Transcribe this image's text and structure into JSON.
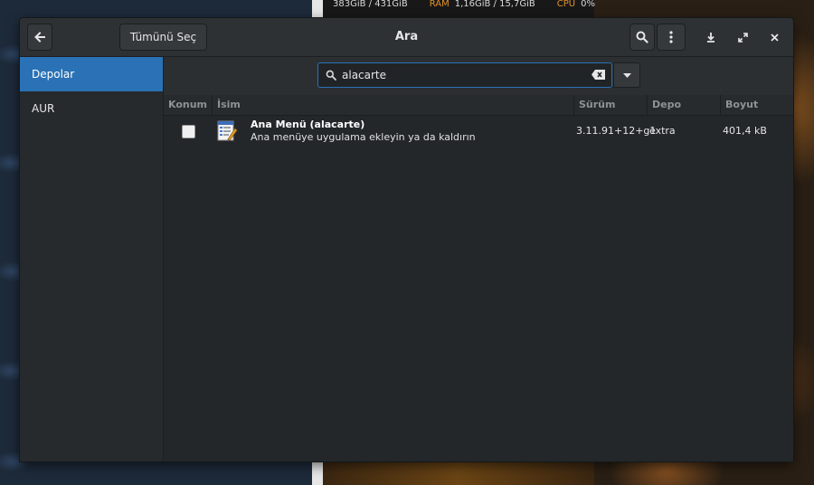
{
  "desktop": {
    "conky": {
      "disk_value": "383GiB / 431GiB",
      "ram_label": "RAM",
      "ram_value": "1,16GiB / 15,7GiB",
      "cpu_label": "CPU",
      "cpu_value": "0%"
    }
  },
  "window": {
    "title": "Ara",
    "select_all_label": "Tümünü Seç",
    "icons": {
      "back": "back-arrow-icon",
      "search": "search-icon",
      "menu": "kebab-menu-icon",
      "download": "download-icon",
      "maximize": "maximize-icon",
      "close": "close-icon"
    }
  },
  "sidebar": {
    "items": [
      {
        "label": "Depolar",
        "active": true
      },
      {
        "label": "AUR",
        "active": false
      }
    ]
  },
  "search": {
    "value": "alacarte",
    "placeholder": ""
  },
  "table": {
    "columns": [
      "Konum",
      "İsim",
      "Sürüm",
      "Depo",
      "Boyut"
    ],
    "rows": [
      {
        "checked": false,
        "name": "Ana Menü  (alacarte)",
        "description": "Ana menüye uygulama ekleyin ya da kaldırın",
        "version": "3.11.91+12+g1",
        "repo": "extra",
        "size": "401,4 kB"
      }
    ]
  },
  "colors": {
    "accent": "#2a72b5",
    "window_bg": "#2b2f32",
    "conky_label": "#e0902a"
  }
}
